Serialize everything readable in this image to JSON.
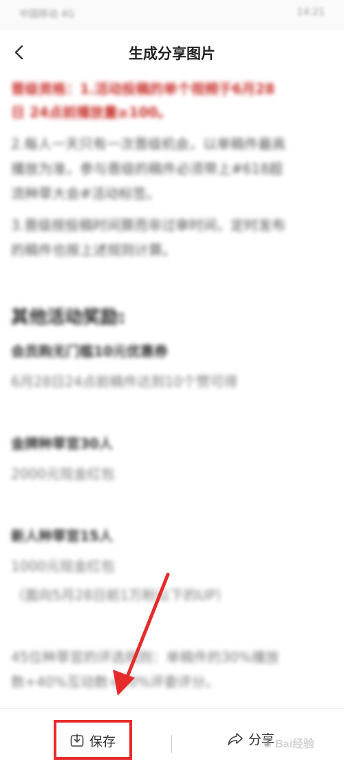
{
  "status_bar": {
    "left_text": "中国移动 4G",
    "right_text": "14:21"
  },
  "nav": {
    "title": "生成分享图片"
  },
  "content": {
    "lines": [
      {
        "text": "晋级资格：1.活动投稿的单个视频于6月28",
        "style": "red"
      },
      {
        "text": "日 24点前播放量≥100。",
        "style": "red"
      },
      {
        "text": "2.每人一天只有一次晋级机会，以单稿件最高",
        "style": "gray"
      },
      {
        "text": "播放为准，参与晋级的稿件必须带上#618超",
        "style": "gray"
      },
      {
        "text": "流种草大会#活动标签。",
        "style": "gray"
      },
      {
        "text": "3.晋级按投稿时间算而非过审时间，定时发布",
        "style": "gray"
      },
      {
        "text": "的稿件也按上述规则计算。",
        "style": "gray"
      },
      {
        "text": "其他活动奖励:",
        "style": "head"
      },
      {
        "text": "会员购无门槛10元优惠券",
        "style": "bold"
      },
      {
        "text": "6月28日24点前稿件达到10个赞可得",
        "style": "light"
      },
      {
        "text": "金牌种草官30人",
        "style": "bold"
      },
      {
        "text": "2000元现金红包",
        "style": "light"
      },
      {
        "text": "新人种草官15人",
        "style": "bold"
      },
      {
        "text": "1000元现金红包",
        "style": "light"
      },
      {
        "text": "（面向5月28日前1万粉以下的UP）",
        "style": "light"
      },
      {
        "text": "45位种草官的评选规则：单稿件的30%播放",
        "style": "light"
      },
      {
        "text": "数+40%互动数+30%评委评分。",
        "style": "light"
      }
    ]
  },
  "bottom_bar": {
    "save_label": "保存",
    "share_label": "分享"
  },
  "watermark": {
    "text": "Bai经验"
  },
  "colors": {
    "highlight_red": "#e62b2b",
    "title_text": "#222222"
  }
}
